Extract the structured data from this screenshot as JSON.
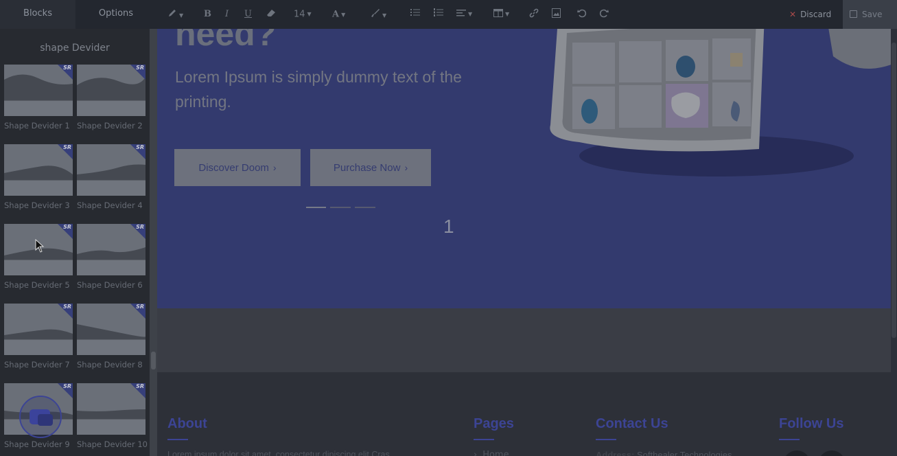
{
  "toolbar": {
    "tab_blocks": "Blocks",
    "tab_options": "Options",
    "font_size": "14",
    "discard_label": "Discard",
    "save_label": "Save",
    "icons": [
      "pen-icon",
      "bold-icon",
      "italic-icon",
      "underline-icon",
      "eraser-icon",
      "font-size-select",
      "font-color-icon",
      "brush-icon",
      "bullet-list-icon",
      "numbered-list-icon",
      "align-icon",
      "table-icon",
      "link-icon",
      "image-icon",
      "undo-icon",
      "redo-icon"
    ]
  },
  "sidebar": {
    "title": "shape Devider",
    "badge": "SR",
    "items": [
      {
        "label": "Shape Devider 1"
      },
      {
        "label": "Shape Devider 2"
      },
      {
        "label": "Shape Devider 3"
      },
      {
        "label": "Shape Devider 4"
      },
      {
        "label": "Shape Devider 5"
      },
      {
        "label": "Shape Devider 6"
      },
      {
        "label": "Shape Devider 7"
      },
      {
        "label": "Shape Devider 8"
      },
      {
        "label": "Shape Devider 9"
      },
      {
        "label": "Shape Devider 10"
      }
    ]
  },
  "hero": {
    "heading": "need?",
    "subtext": "Lorem Ipsum is simply dummy text of the printing.",
    "button_discover": "Discover Doom",
    "button_purchase": "Purchase Now",
    "slide_number": "1"
  },
  "footer": {
    "about_heading": "About",
    "about_text": "Lorem ipsum dolor sit amet, consectetur dipiscing elit Cras",
    "pages_heading": "Pages",
    "pages_first": "Home",
    "contact_heading": "Contact Us",
    "contact_address_label": "Address:",
    "contact_address_value": "Softhealer Technologies",
    "follow_heading": "Follow Us"
  },
  "colors": {
    "accent": "#3c4494",
    "hero_bg": "#333a6e",
    "toolbar_bg": "#23272f",
    "sidebar_bg": "#272a30",
    "discard_x": "#a84a4a"
  }
}
